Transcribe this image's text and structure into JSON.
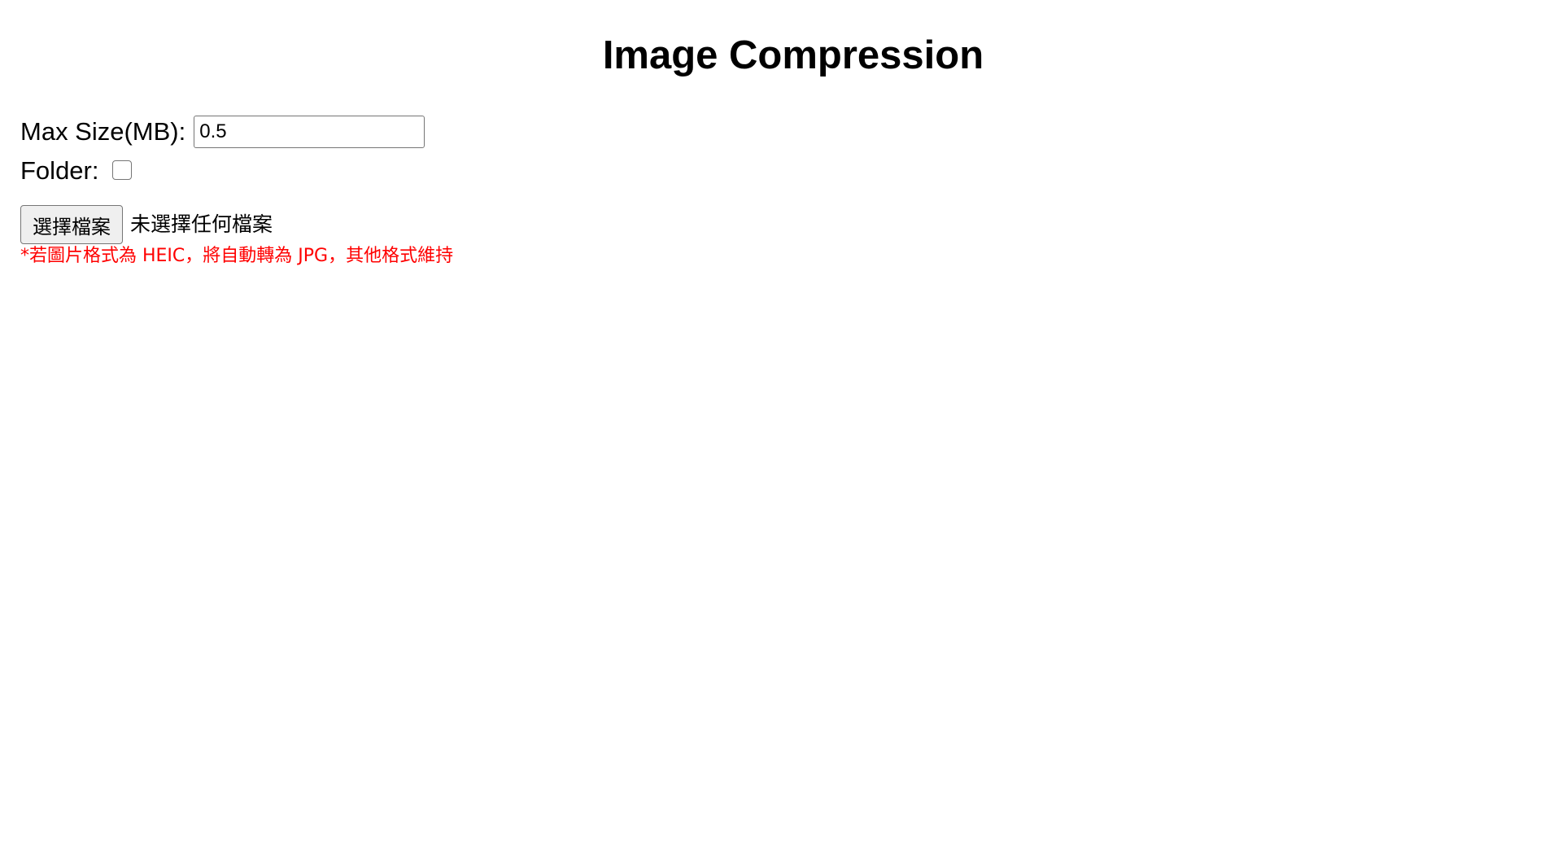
{
  "page": {
    "title": "Image Compression"
  },
  "form": {
    "max_size_label": "Max Size(MB):",
    "max_size_value": "0.5",
    "folder_label": "Folder:",
    "folder_checked": false,
    "file_button_label": "選擇檔案",
    "file_status": "未選擇任何檔案",
    "note": "*若圖片格式為 HEIC，將自動轉為 JPG，其他格式維持"
  },
  "colors": {
    "note": "#ff0000",
    "button_bg": "#efefef",
    "border": "#767676"
  }
}
